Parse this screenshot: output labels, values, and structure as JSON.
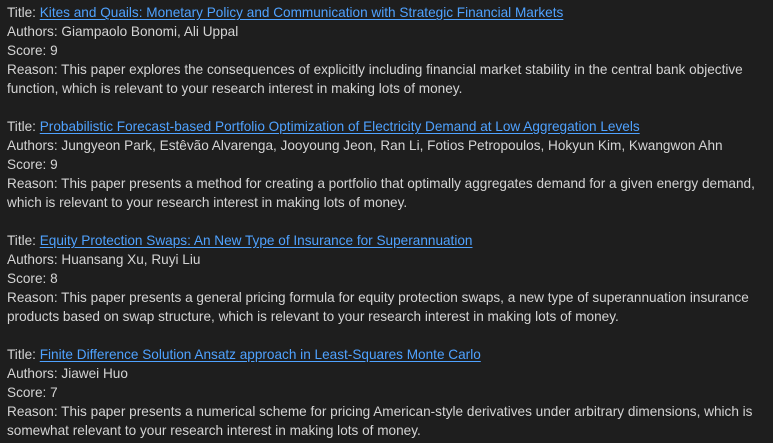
{
  "labels": {
    "title": "Title: ",
    "authors": "Authors: ",
    "score": "Score: ",
    "reason": "Reason: "
  },
  "colors": {
    "background": "#1e1e1e",
    "text": "#d4d4d4",
    "link": "#4fa2ff"
  },
  "papers": [
    {
      "title": "Kites and Quails: Monetary Policy and Communication with Strategic Financial Markets",
      "authors": "Giampaolo Bonomi, Ali Uppal",
      "score": "9",
      "reason": "This paper explores the consequences of explicitly including financial market stability in the central bank objective function, which is relevant to your research interest in making lots of money."
    },
    {
      "title": "Probabilistic Forecast-based Portfolio Optimization of Electricity Demand at Low Aggregation Levels",
      "authors": "Jungyeon Park, Estêvão Alvarenga, Jooyoung Jeon, Ran Li, Fotios Petropoulos, Hokyun Kim, Kwangwon Ahn",
      "score": "9",
      "reason": "This paper presents a method for creating a portfolio that optimally aggregates demand for a given energy demand, which is relevant to your research interest in making lots of money."
    },
    {
      "title": "Equity Protection Swaps: An New Type of Insurance for Superannuation",
      "authors": "Huansang Xu, Ruyi Liu",
      "score": "8",
      "reason": "This paper presents a general pricing formula for equity protection swaps, a new type of superannuation insurance products based on swap structure, which is relevant to your research interest in making lots of money."
    },
    {
      "title": "Finite Difference Solution Ansatz approach in Least-Squares Monte Carlo",
      "authors": "Jiawei Huo",
      "score": "7",
      "reason": "This paper presents a numerical scheme for pricing American-style derivatives under arbitrary dimensions, which is somewhat relevant to your research interest in making lots of money."
    }
  ]
}
